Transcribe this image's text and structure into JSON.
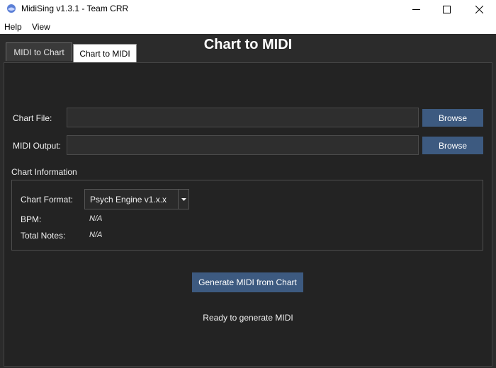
{
  "window": {
    "title": "MidiSing v1.3.1 - Team CRR",
    "icon": "app-logo-icon"
  },
  "menu": [
    {
      "label": "Help"
    },
    {
      "label": "View"
    }
  ],
  "tabs": [
    {
      "label": "MIDI to Chart",
      "active": false
    },
    {
      "label": "Chart to MIDI",
      "active": true
    }
  ],
  "main": {
    "heading": "Chart to MIDI",
    "chart_file": {
      "label": "Chart File:",
      "value": "",
      "browse_label": "Browse"
    },
    "midi_output": {
      "label": "MIDI Output:",
      "value": "",
      "browse_label": "Browse"
    },
    "chart_info": {
      "title": "Chart Information",
      "format_label": "Chart Format:",
      "format_value": "Psych Engine v1.x.x",
      "bpm_label": "BPM:",
      "bpm_value": "N/A",
      "notes_label": "Total Notes:",
      "notes_value": "N/A"
    },
    "generate_label": "Generate MIDI from Chart",
    "status": "Ready to generate MIDI"
  },
  "colors": {
    "background": "#2b2b2b",
    "panel": "#232323",
    "button": "#3d5a80",
    "text": "#f0f0f0"
  }
}
